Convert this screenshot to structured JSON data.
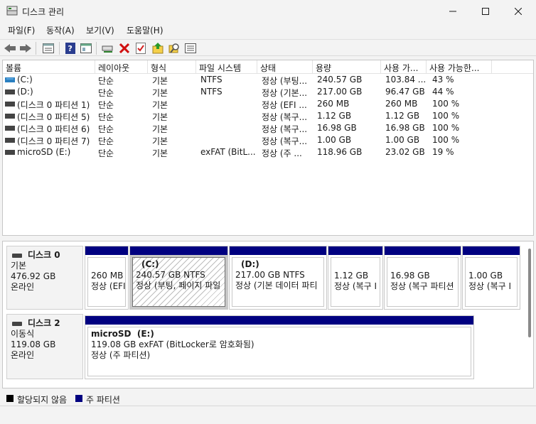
{
  "window": {
    "title": "디스크 관리",
    "icon": "disk-management-icon"
  },
  "menu": [
    {
      "label": "파일(F)"
    },
    {
      "label": "동작(A)"
    },
    {
      "label": "보기(V)"
    },
    {
      "label": "도움말(H)"
    }
  ],
  "toolbar": [
    "back-arrow-icon",
    "forward-arrow-icon",
    "list-view-icon",
    "help-icon",
    "properties-icon",
    "connect-disk-icon",
    "delete-icon",
    "check-icon",
    "import-icon",
    "search-icon",
    "settings-list-icon"
  ],
  "columns": [
    "볼륨",
    "레이아웃",
    "형식",
    "파일 시스템",
    "상태",
    "용량",
    "사용 가...",
    "사용 가능한..."
  ],
  "volumes": [
    {
      "name": "(C:)",
      "layout": "단순",
      "type": "기본",
      "fs": "NTFS",
      "status": "정상 (부팅...",
      "capacity": "240.57 GB",
      "free": "103.84 ...",
      "pct": "43 %"
    },
    {
      "name": "(D:)",
      "layout": "단순",
      "type": "기본",
      "fs": "NTFS",
      "status": "정상 (기본...",
      "capacity": "217.00 GB",
      "free": "96.47 GB",
      "pct": "44 %"
    },
    {
      "name": "(디스크 0 파티션 1)",
      "layout": "단순",
      "type": "기본",
      "fs": "",
      "status": "정상 (EFI ...",
      "capacity": "260 MB",
      "free": "260 MB",
      "pct": "100 %"
    },
    {
      "name": "(디스크 0 파티션 5)",
      "layout": "단순",
      "type": "기본",
      "fs": "",
      "status": "정상 (복구...",
      "capacity": "1.12 GB",
      "free": "1.12 GB",
      "pct": "100 %"
    },
    {
      "name": "(디스크 0 파티션 6)",
      "layout": "단순",
      "type": "기본",
      "fs": "",
      "status": "정상 (복구...",
      "capacity": "16.98 GB",
      "free": "16.98 GB",
      "pct": "100 %"
    },
    {
      "name": "(디스크 0 파티션 7)",
      "layout": "단순",
      "type": "기본",
      "fs": "",
      "status": "정상 (복구...",
      "capacity": "1.00 GB",
      "free": "1.00 GB",
      "pct": "100 %"
    },
    {
      "name": "microSD (E:)",
      "layout": "단순",
      "type": "기본",
      "fs": "exFAT (BitL...",
      "status": "정상 (주 ...",
      "capacity": "118.96 GB",
      "free": "23.02 GB",
      "pct": "19 %"
    }
  ],
  "disks": [
    {
      "name": "디스크 0",
      "kind": "기본",
      "size": "476.92 GB",
      "state": "온라인",
      "partitions": [
        {
          "title": "",
          "line1": "260 MB",
          "line2": "정상 (EFI"
        },
        {
          "title": "(C:)",
          "line1": "240.57 GB NTFS",
          "line2": "정상 (부팅, 페이지 파일"
        },
        {
          "title": "(D:)",
          "line1": "217.00 GB NTFS",
          "line2": "정상 (기본 데이터 파티"
        },
        {
          "title": "",
          "line1": "1.12 GB",
          "line2": "정상 (복구 I"
        },
        {
          "title": "",
          "line1": "16.98 GB",
          "line2": "정상 (복구 파티션"
        },
        {
          "title": "",
          "line1": "1.00 GB",
          "line2": "정상 (복구 I"
        }
      ]
    },
    {
      "name": "디스크 2",
      "kind": "이동식",
      "size": "119.08 GB",
      "state": "온라인",
      "partitions": [
        {
          "title": "microSD  (E:)",
          "line1": "119.08 GB exFAT (BitLocker로 암호화됨)",
          "line2": "정상 (주 파티션)"
        }
      ]
    }
  ],
  "legend": [
    {
      "label": "할당되지 않음",
      "color": "#000000"
    },
    {
      "label": "주 파티션",
      "color": "#000080"
    }
  ]
}
